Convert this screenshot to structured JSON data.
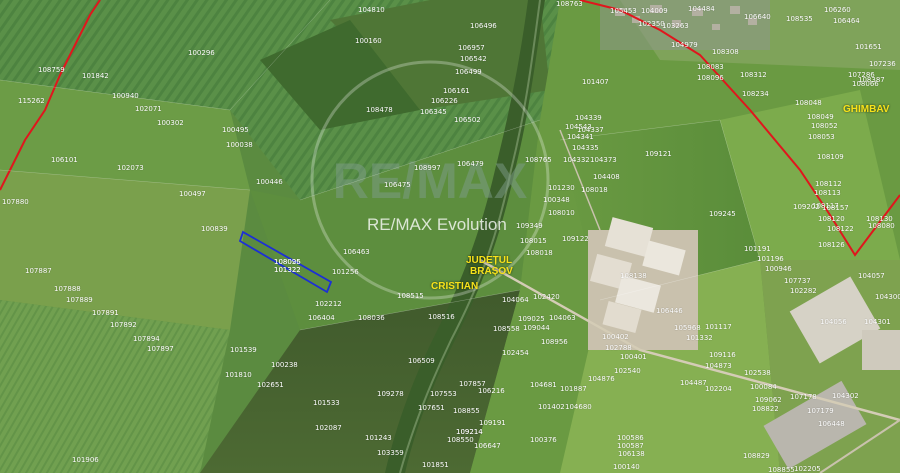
{
  "map": {
    "watermark": {
      "logo_text": "RE/MAX",
      "caption": "RE/MAX Evolution"
    },
    "places": {
      "ghimbav": "GHIMBAV",
      "judetul": "JUDEȚUL",
      "brasov": "BRAȘOV",
      "cristian": "CRISTIAN"
    },
    "highlighted_parcel": {
      "id_top": "108096",
      "id_bottom": "101322"
    },
    "colors": {
      "boundary": "#e0161d",
      "highlight": "#1c2fd6",
      "label": "#ffffff",
      "place": "#f7e21a"
    },
    "parcels": [
      "104810",
      "106496",
      "108763",
      "105453",
      "102350",
      "104484",
      "106640",
      "108535",
      "106260",
      "106464",
      "100160",
      "106957",
      "106542",
      "106499",
      "100296",
      "108759",
      "101842",
      "100940",
      "115262",
      "102071",
      "100302",
      "100495",
      "106161",
      "106226",
      "106502",
      "106345",
      "108478",
      "100038",
      "106101",
      "102073",
      "106479",
      "108997",
      "100446",
      "106475",
      "100497",
      "100839",
      "106463",
      "101256",
      "108025",
      "101322",
      "107887",
      "107888",
      "107889",
      "107891",
      "107892",
      "107894",
      "107897",
      "107880",
      "102212",
      "106404",
      "108515",
      "108516",
      "108036",
      "101539",
      "101810",
      "100238",
      "102651",
      "101533",
      "102087",
      "101243",
      "106509",
      "109278",
      "101906",
      "107651",
      "108855",
      "103359",
      "101851",
      "101407",
      "104543",
      "104341",
      "104339",
      "104337",
      "104335",
      "104332",
      "104373",
      "108765",
      "108018",
      "101230",
      "100348",
      "108010",
      "109349",
      "108015",
      "108018",
      "109122",
      "109121",
      "109245",
      "101191",
      "101196",
      "100946",
      "107737",
      "102282",
      "104057",
      "104300",
      "104056",
      "104301",
      "108138",
      "106446",
      "105968",
      "101117",
      "101332",
      "109116",
      "104873",
      "102538",
      "100084",
      "102204",
      "109062",
      "108822",
      "107178",
      "107179",
      "104302",
      "106448",
      "104408",
      "104009",
      "103263",
      "104979",
      "108308",
      "108083",
      "108096",
      "108312",
      "108234",
      "108048",
      "108049",
      "108052",
      "108053",
      "108109",
      "108112",
      "108113",
      "108117",
      "108120",
      "108122",
      "108126",
      "108080",
      "108130",
      "108157",
      "109202",
      "108066",
      "101651",
      "107236",
      "107286",
      "108387",
      "104681",
      "101402",
      "100376",
      "100402",
      "100401",
      "102540",
      "104876",
      "107857",
      "106216",
      "107553",
      "101887",
      "102420",
      "104064",
      "104063",
      "109025",
      "109044",
      "108558",
      "108956",
      "102788",
      "102454",
      "104487",
      "104680",
      "100586",
      "106138",
      "100140",
      "100587",
      "108829",
      "108855",
      "102205",
      "106647",
      "108550",
      "109214",
      "109191",
      "109214"
    ]
  }
}
